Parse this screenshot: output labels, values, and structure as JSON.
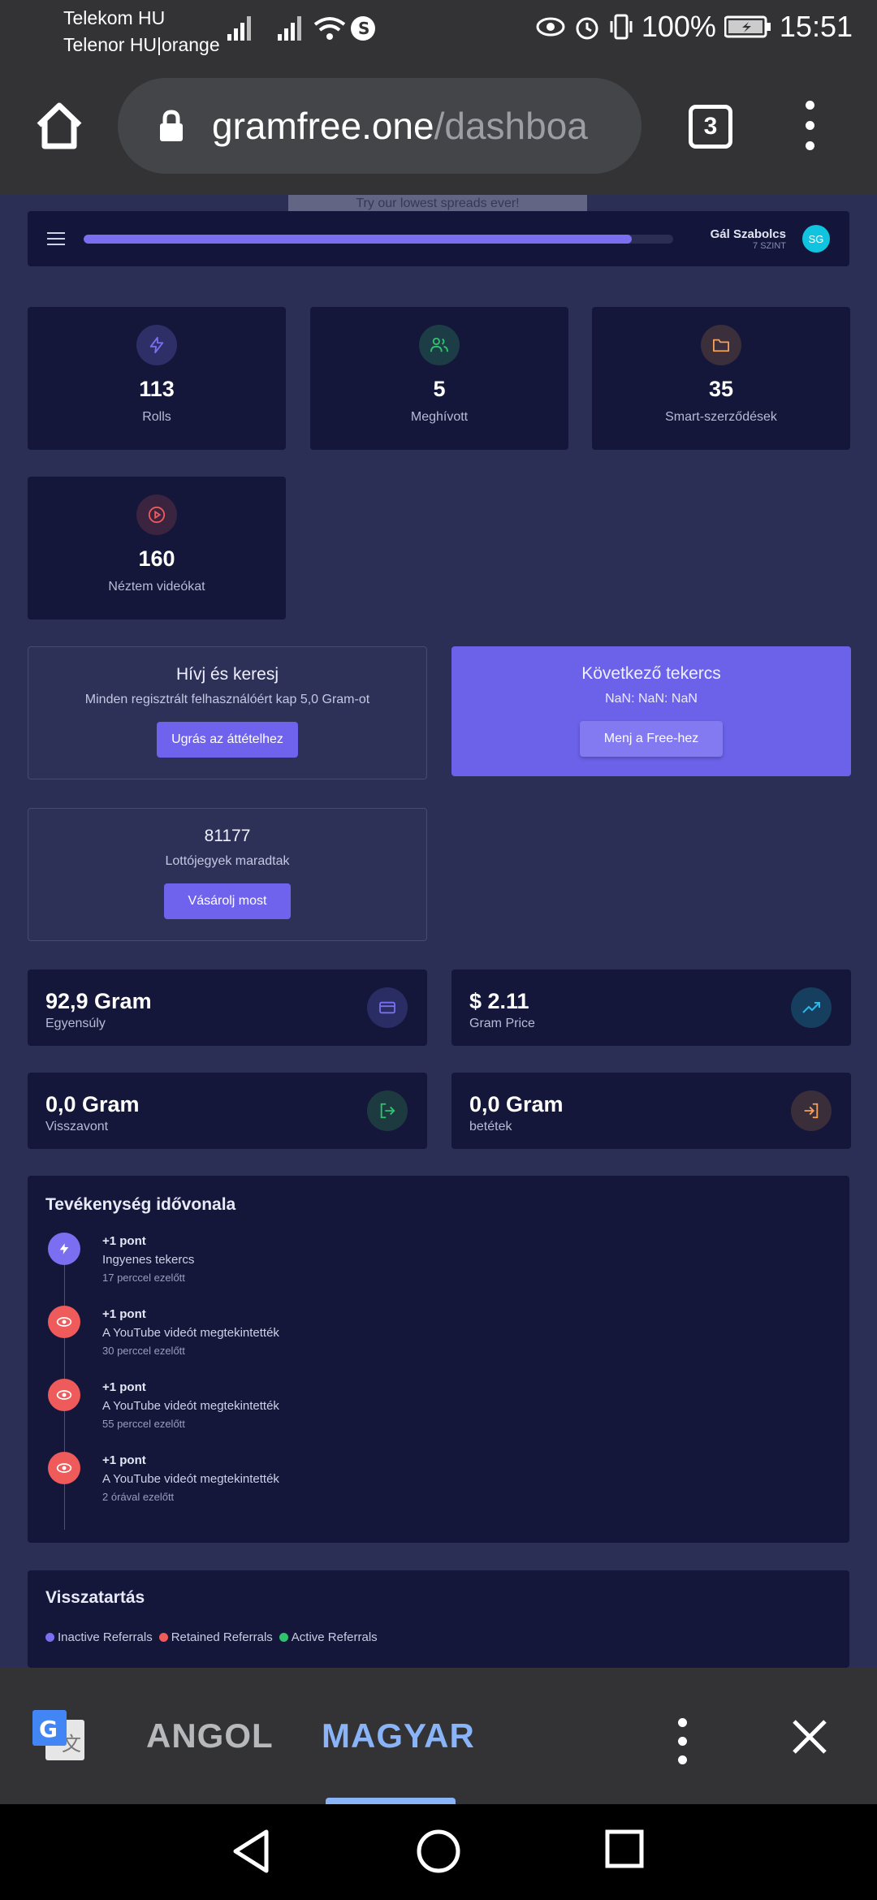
{
  "status_bar": {
    "carrier1": "Telekom HU",
    "carrier2": "Telenor HU|orange",
    "battery": "100%",
    "time": "15:51"
  },
  "browser": {
    "url_domain": "gramfree.one",
    "url_path": "/dashboa",
    "tab_count": "3"
  },
  "ad": {
    "text": "Try our lowest spreads ever!"
  },
  "header": {
    "user_name": "Gál Szabolcs",
    "user_level": "7 SZINT",
    "avatar_initials": "SG",
    "level_progress_percent": 93
  },
  "stats": [
    {
      "value": "113",
      "label": "Rolls",
      "icon": "bolt-icon"
    },
    {
      "value": "5",
      "label": "Meghívott",
      "icon": "users-icon"
    },
    {
      "value": "35",
      "label": "Smart-szerződések",
      "icon": "folder-icon"
    },
    {
      "value": "160",
      "label": "Néztem videókat",
      "icon": "play-icon"
    }
  ],
  "invite": {
    "title": "Hívj és keresj",
    "text": "Minden regisztrált felhasználóért kap 5,0 Gram-ot",
    "button": "Ugrás az áttételhez"
  },
  "next_roll": {
    "title": "Következő tekercs",
    "countdown": "NaN: NaN: NaN",
    "button": "Menj a Free-hez"
  },
  "lottery": {
    "count": "81177",
    "text": "Lottójegyek maradtak",
    "button": "Vásárolj most"
  },
  "balances": [
    {
      "value": "92,9 Gram",
      "label": "Egyensúly",
      "icon": "wallet-card-icon"
    },
    {
      "value": "$ 2.11",
      "label": "Gram Price",
      "icon": "trending-up-icon"
    },
    {
      "value": "0,0 Gram",
      "label": "Visszavont",
      "icon": "logout-icon"
    },
    {
      "value": "0,0 Gram",
      "label": "betétek",
      "icon": "login-icon"
    }
  ],
  "timeline": {
    "title": "Tevékenység idővonala",
    "items": [
      {
        "points": "+1 pont",
        "desc": "Ingyenes tekercs",
        "time": "17 perccel ezelőtt",
        "icon": "bolt-icon"
      },
      {
        "points": "+1 pont",
        "desc": "A YouTube videót megtekintették",
        "time": "30 perccel ezelőtt",
        "icon": "eye-icon"
      },
      {
        "points": "+1 pont",
        "desc": "A YouTube videót megtekintették",
        "time": "55 perccel ezelőtt",
        "icon": "eye-icon"
      },
      {
        "points": "+1 pont",
        "desc": "A YouTube videót megtekintették",
        "time": "2 órával ezelőtt",
        "icon": "eye-icon"
      }
    ]
  },
  "retention": {
    "title": "Visszatartás",
    "legend": [
      {
        "label": "Inactive Referrals",
        "color": "#7b6ef0"
      },
      {
        "label": "Retained Referrals",
        "color": "#ef5a5a"
      },
      {
        "label": "Active Referrals",
        "color": "#2ec46f"
      }
    ]
  },
  "translate_bar": {
    "source_lang": "ANGOL",
    "target_lang": "MAGYAR"
  },
  "colors": {
    "accent": "#7b6ef0",
    "page_bg": "#2b2f56",
    "card_bg": "#14163a",
    "danger": "#ef5a5a",
    "success": "#2ec46f"
  }
}
